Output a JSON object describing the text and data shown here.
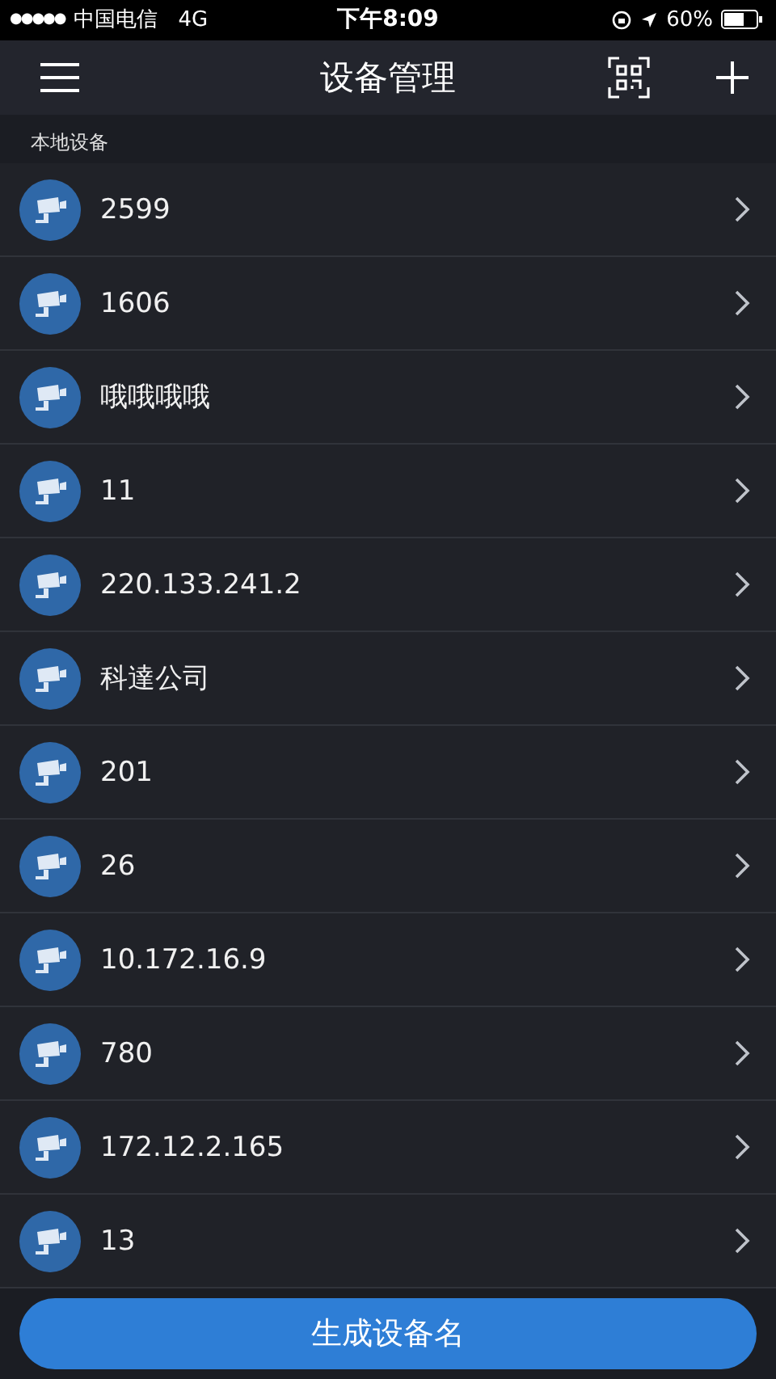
{
  "status_bar": {
    "signal": "●●●●●",
    "carrier": "中国电信",
    "network": "4G",
    "time": "下午8:09",
    "battery": "60%"
  },
  "nav": {
    "title": "设备管理"
  },
  "section": {
    "title": "本地设备"
  },
  "devices": [
    {
      "name": "2599"
    },
    {
      "name": "1606"
    },
    {
      "name": "哦哦哦哦"
    },
    {
      "name": "11"
    },
    {
      "name": "220.133.241.2"
    },
    {
      "name": "科達公司"
    },
    {
      "name": "201"
    },
    {
      "name": "26"
    },
    {
      "name": "10.172.16.9"
    },
    {
      "name": "780"
    },
    {
      "name": "172.12.2.165"
    },
    {
      "name": "13"
    }
  ],
  "action_button": {
    "label": "生成设备名"
  }
}
